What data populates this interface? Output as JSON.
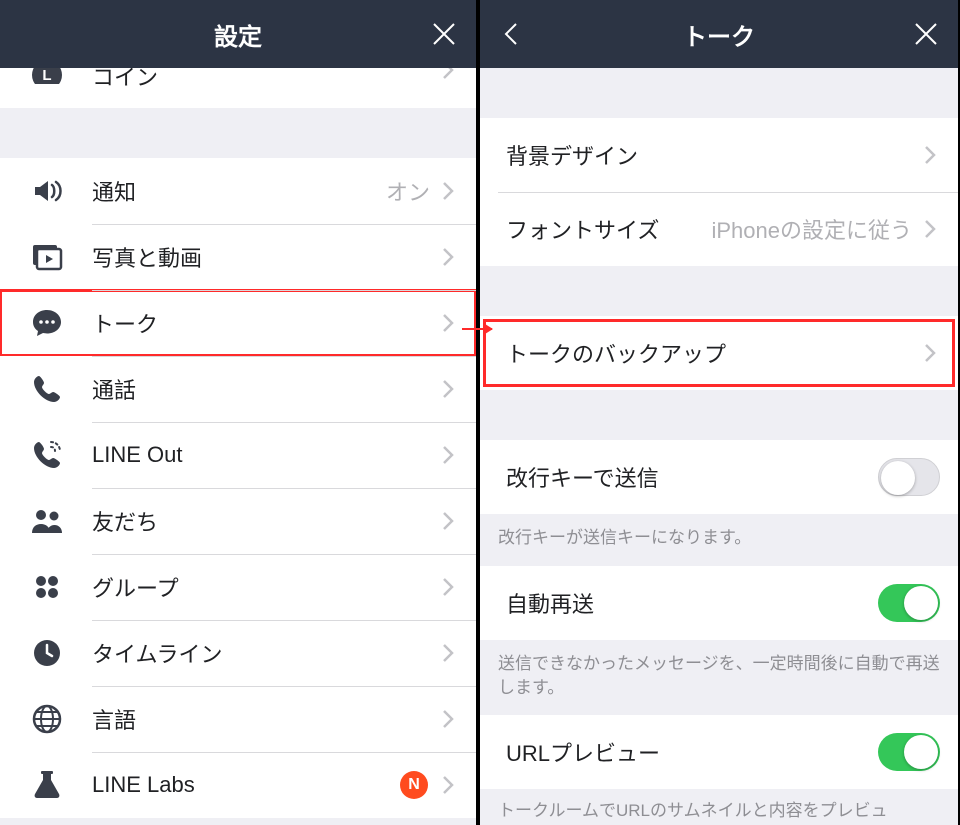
{
  "left": {
    "header": {
      "title": "設定"
    },
    "items": {
      "coin": {
        "label": "コイン"
      },
      "notify": {
        "label": "通知",
        "value": "オン"
      },
      "media": {
        "label": "写真と動画"
      },
      "talk": {
        "label": "トーク"
      },
      "call": {
        "label": "通話"
      },
      "lineout": {
        "label": "LINE Out"
      },
      "friends": {
        "label": "友だち"
      },
      "groups": {
        "label": "グループ"
      },
      "timeline": {
        "label": "タイムライン"
      },
      "lang": {
        "label": "言語"
      },
      "labs": {
        "label": "LINE Labs",
        "badge": "N"
      }
    }
  },
  "right": {
    "header": {
      "title": "トーク"
    },
    "items": {
      "bg": {
        "label": "背景デザイン"
      },
      "font": {
        "label": "フォントサイズ",
        "value": "iPhoneの設定に従う"
      },
      "backup": {
        "label": "トークのバックアップ"
      },
      "enter_send": {
        "label": "改行キーで送信",
        "help": "改行キーが送信キーになります。"
      },
      "auto_resend": {
        "label": "自動再送",
        "help": "送信できなかったメッセージを、一定時間後に自動で再送します。"
      },
      "url_preview": {
        "label": "URLプレビュー",
        "help": "トークルームでURLのサムネイルと内容をプレビュ"
      }
    }
  }
}
